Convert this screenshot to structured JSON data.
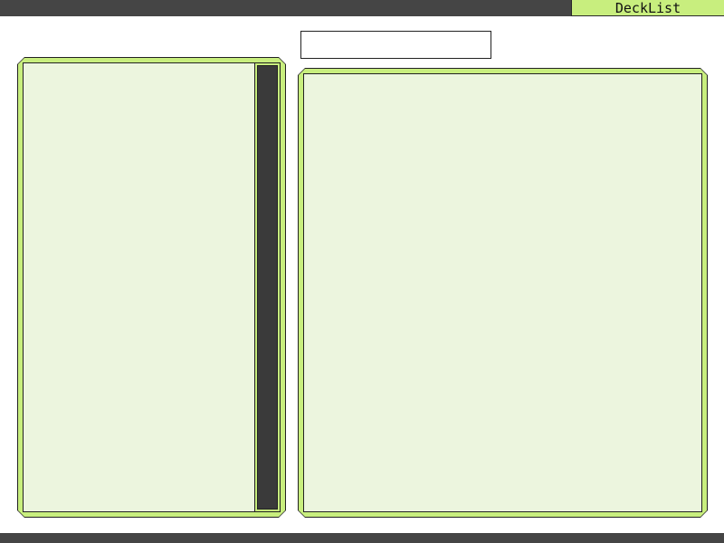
{
  "app": {
    "title": "DeckList"
  },
  "search": {
    "value": "",
    "placeholder": ""
  },
  "card_list": {
    "items": []
  },
  "detail_panel": {
    "content": ""
  },
  "colors": {
    "bar": "#454545",
    "accent_green": "#c8ee7e",
    "panel_fill": "#ecf5de",
    "scroll_thumb": "#3a3a3a"
  }
}
